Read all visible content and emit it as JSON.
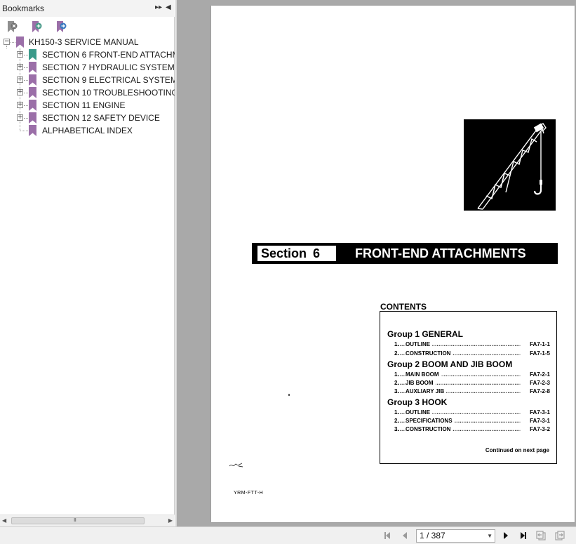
{
  "panel": {
    "title": "Bookmarks",
    "header_buttons": [
      "options-icon",
      "collapse-panel-icon"
    ],
    "toolbar_icons": [
      "delete-bookmark-icon",
      "expand-bookmark-icon",
      "go-to-bookmark-icon"
    ]
  },
  "bookmarks": {
    "root": "KH150-3 SERVICE MANUAL",
    "items": [
      {
        "label": "SECTION 6 FRONT-END ATTACHM",
        "expandable": true,
        "active": true
      },
      {
        "label": "SECTION 7 HYDRAULIC SYSTEM",
        "expandable": true,
        "active": false
      },
      {
        "label": "SECTION 9 ELECTRICAL SYSTEM",
        "expandable": true,
        "active": false
      },
      {
        "label": "SECTION 10 TROUBLESHOOTING",
        "expandable": true,
        "active": false
      },
      {
        "label": "SECTION 11 ENGINE",
        "expandable": true,
        "active": false
      },
      {
        "label": "SECTION 12 SAFETY DEVICE",
        "expandable": true,
        "active": false
      },
      {
        "label": "ALPHABETICAL INDEX",
        "expandable": false,
        "active": false
      }
    ]
  },
  "scrollbar": {
    "grip": "III"
  },
  "document": {
    "section_label": "Section",
    "section_number": "6",
    "section_title": "FRONT-END ATTACHMENTS",
    "contents_heading": "CONTENTS",
    "groups": [
      {
        "title": "Group 1  GENERAL",
        "items": [
          {
            "num": "1.",
            "name": "OUTLINE",
            "ref": "FA7-1-1"
          },
          {
            "num": "2.",
            "name": "CONSTRUCTION",
            "ref": "FA7-1-5"
          }
        ]
      },
      {
        "title": "Group 2  BOOM AND JIB BOOM",
        "items": [
          {
            "num": "1.",
            "name": "MAIN BOOM",
            "ref": "FA7-2-1"
          },
          {
            "num": "2.",
            "name": "JIB BOOM",
            "ref": "FA7-2-3"
          },
          {
            "num": "3.",
            "name": "AUXLIARY JIB",
            "ref": "FA7-2-8"
          }
        ]
      },
      {
        "title": "Group 3  HOOK",
        "items": [
          {
            "num": "1.",
            "name": "OUTLINE",
            "ref": "FA7-3-1"
          },
          {
            "num": "2.",
            "name": "SPECIFICATIONS",
            "ref": "FA7-3-1"
          },
          {
            "num": "3.",
            "name": "CONSTRUCTION",
            "ref": "FA7-3-2"
          }
        ]
      }
    ],
    "continued": "Continued on next page",
    "page_code": "YRM-FTT-H"
  },
  "navigation": {
    "page_indicator": "1 / 387",
    "buttons": [
      "first-page-icon",
      "previous-page-icon",
      "next-page-icon",
      "last-page-icon",
      "previous-view-icon",
      "next-view-icon"
    ]
  },
  "colors": {
    "bookmark_active": "#3a9a8a",
    "bookmark_default": "#9b6fa8",
    "viewer_bg": "#a9a9a9"
  }
}
